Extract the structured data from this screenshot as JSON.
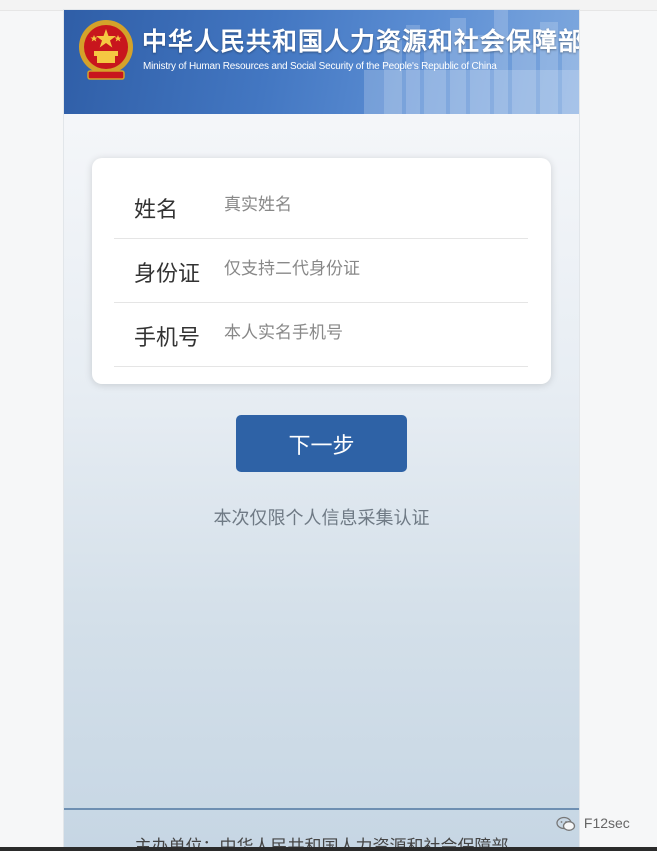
{
  "header": {
    "title_cn": "中华人民共和国人力资源和社会保障部",
    "title_en": "Ministry of Human Resources and Social Security of the People's Republic of China",
    "emblem_icon": "national-emblem-icon"
  },
  "form": {
    "fields": [
      {
        "label": "姓名",
        "placeholder": "真实姓名",
        "value": ""
      },
      {
        "label": "身份证",
        "placeholder": "仅支持二代身份证",
        "value": ""
      },
      {
        "label": "手机号",
        "placeholder": "本人实名手机号",
        "value": ""
      }
    ]
  },
  "actions": {
    "next_label": "下一步"
  },
  "notice": "本次仅限个人信息采集认证",
  "footer": {
    "text": "主办单位：中华人民共和国人力资源和社会保障部"
  },
  "watermark": {
    "text": "F12sec",
    "icon": "wechat-icon"
  },
  "colors": {
    "banner": "#3f72bd",
    "button": "#2e62a6",
    "notice_text": "#6f7a85"
  }
}
